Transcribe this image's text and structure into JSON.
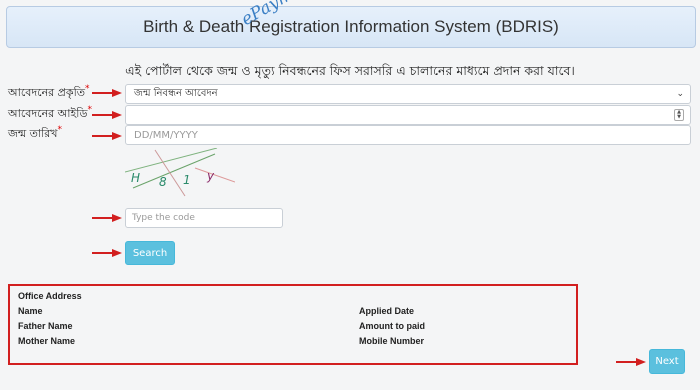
{
  "header": {
    "title": "Birth & Death Registration Information System (BDRIS)"
  },
  "watermark": "ePayment",
  "notice": "এই পোর্টাল থেকে জন্ম ও মৃত্যু নিবন্ধনের ফিস সরাসরি এ চালানের মাধ্যমে প্রদান করা যাবে।",
  "form": {
    "application_type": {
      "label": "আবেদনের প্রকৃতি",
      "value": "জন্ম নিবন্ধন আবেদন"
    },
    "application_id": {
      "label": "আবেদনের আইডি",
      "value": ""
    },
    "birth_date": {
      "label": "জন্ম তারিখ",
      "placeholder": "DD/MM/YYYY"
    },
    "required_mark": "*"
  },
  "captcha": {
    "chars": [
      "H",
      "8",
      "1",
      "y"
    ]
  },
  "code_input": {
    "placeholder": "Type the code"
  },
  "buttons": {
    "search": "Search",
    "next": "Next"
  },
  "info": {
    "office_address": "Office Address",
    "name": "Name",
    "father_name": "Father Name",
    "mother_name": "Mother Name",
    "applied_date": "Applied Date",
    "amount_to_paid": "Amount to paid",
    "mobile_number": "Mobile Number"
  },
  "colors": {
    "arrow": "#d21f1f",
    "button": "#5bc0de",
    "header_bg": "#dde9f7",
    "watermark": "#3b7fc4"
  },
  "icons": [
    "red-arrow-icon",
    "chevron-down-icon",
    "spinner-icon"
  ]
}
